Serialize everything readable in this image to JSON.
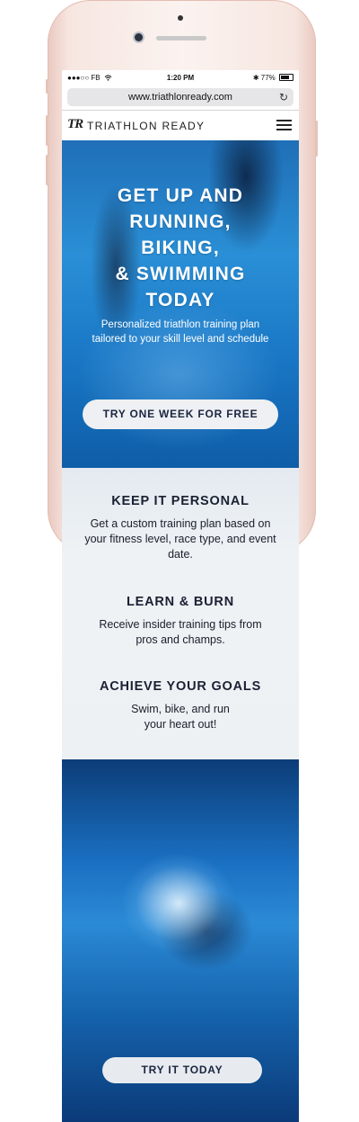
{
  "status_bar": {
    "carrier": "●●●○○ FB",
    "wifi_icon": "wifi-icon",
    "time": "1:20 PM",
    "bluetooth": "✱",
    "battery": "77%"
  },
  "browser": {
    "url": "www.triathlonready.com",
    "reload_icon": "↻"
  },
  "nav": {
    "logo_mark": "TR",
    "brand": "TRIATHLON READY"
  },
  "hero": {
    "headline_lines": [
      "GET UP AND",
      "RUNNING,",
      "BIKING,",
      "& SWIMMING",
      "TODAY"
    ],
    "subtitle": "Personalized triathlon training plan tailored to your skill level and schedule",
    "cta": "TRY ONE WEEK FOR FREE"
  },
  "features": [
    {
      "title": "KEEP IT PERSONAL",
      "text": "Get a custom training plan based on your fitness level, race type, and event date."
    },
    {
      "title": "LEARN & BURN",
      "text": "Receive insider training tips from pros and champs."
    },
    {
      "title": "ACHIEVE YOUR GOALS",
      "text": "Swim, bike, and run your heart out!"
    }
  ],
  "bottom": {
    "cta": "TRY IT TODAY"
  },
  "colors": {
    "frame": "#f7e6e0",
    "hero_blue": "#2a8fd6",
    "button_bg": "#eef0f3",
    "button_text": "#1b2540",
    "feature_bg": "#eef2f5"
  }
}
